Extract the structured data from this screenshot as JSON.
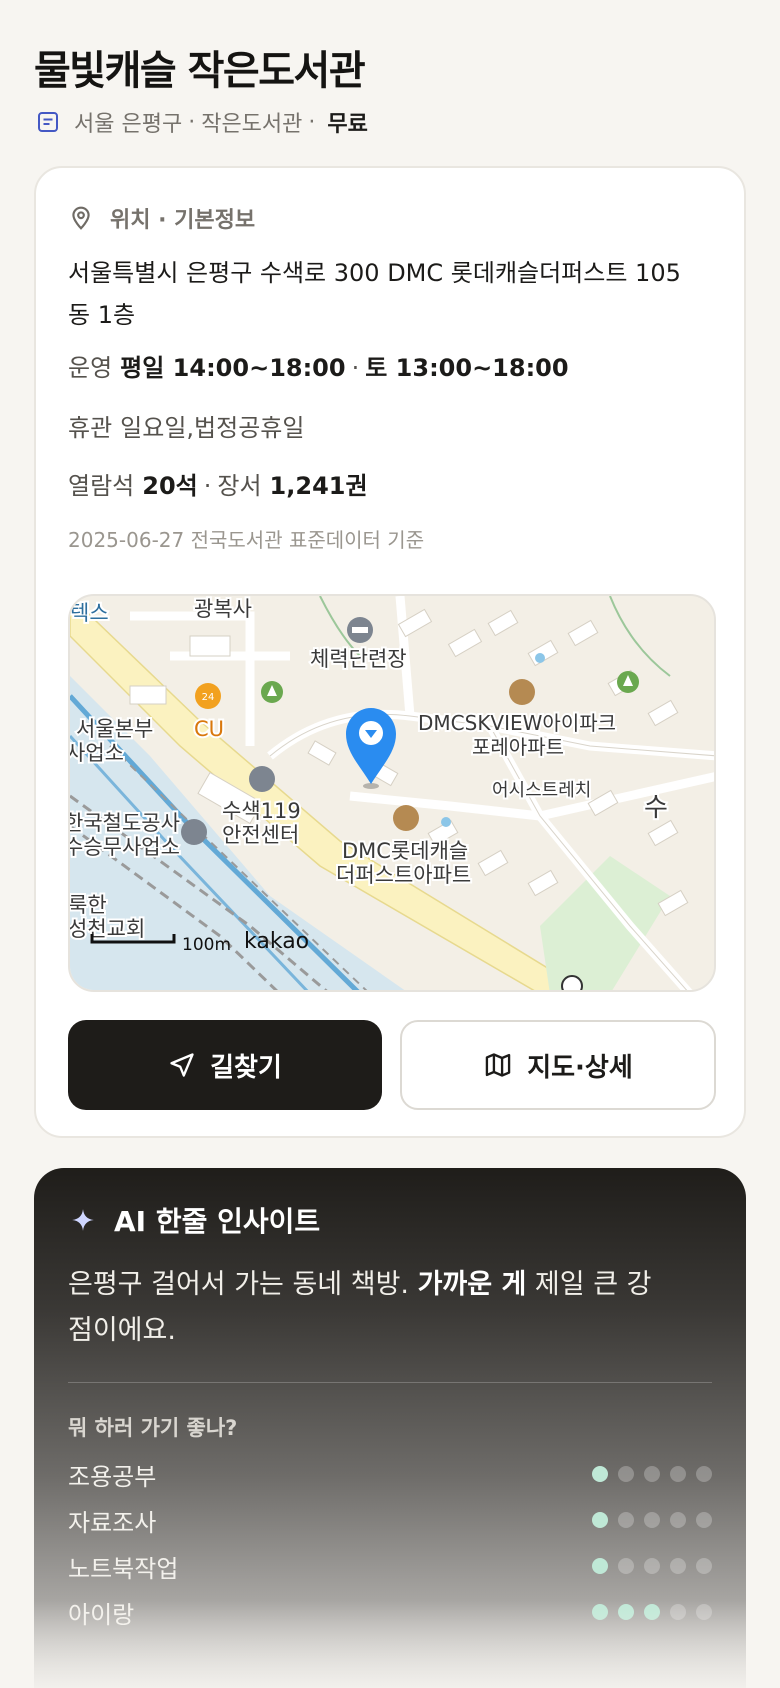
{
  "header": {
    "title": "물빛캐슬 작은도서관",
    "district": "서울 은평구",
    "category": "작은도서관",
    "separator": "·",
    "fee": "무료"
  },
  "info_card": {
    "section_title": "위치 · 기본정보",
    "address": "서울특별시 은평구 수색로 300 DMC 롯데캐슬더퍼스트 105동 1층",
    "hours_label": "운영",
    "weekday_hours": "평일 14:00~18:00",
    "hours_sep": "·",
    "saturday_hours": "토 13:00~18:00",
    "closed_label": "휴관",
    "closed_days": "일요일,법정공휴일",
    "seats_label": "열람석",
    "seats_value": "20석",
    "seats_sep": "·",
    "books_label": "장서",
    "books_value": "1,241권",
    "data_source": "2025-06-27 전국도서관 표준데이터 기준"
  },
  "map": {
    "labels": {
      "l1": "텍스",
      "l2": "광복사",
      "l3": "체력단련장",
      "l4": "CU",
      "l5": "서울본부",
      "l6": "사업소",
      "l7": "DMCSKVIEW아이파크",
      "l8": "포레아파트",
      "l9": "어시스트레치",
      "l10": "수",
      "l11": "수색119",
      "l12": "안전센터",
      "l13": "한국철도공사",
      "l14": "수승무사업소",
      "l15": "DMC롯데캐슬",
      "l16": "더퍼스트아파트",
      "l17": "룩한",
      "l18": "성천교회",
      "scale": "100m",
      "brand": "kakao",
      "cu_badge": "24"
    },
    "colors": {
      "water": "#d6e6ee",
      "river": "#63a9d6",
      "road_major": "#fbf2c0",
      "park": "#dcefd4",
      "marker": "#2a8cf0"
    }
  },
  "buttons": {
    "directions": "길찾기",
    "map_detail": "지도·상세"
  },
  "ai": {
    "title": "AI 한줄 인사이트",
    "text_before": "은평구 걸어서 가는 동네 책방. ",
    "text_bold": "가까운 게",
    "text_after": " 제일 큰 강점이에요.",
    "question": "뭐 하러 가기 좋나?",
    "activities": [
      {
        "name": "조용공부",
        "score": 1,
        "max": 5
      },
      {
        "name": "자료조사",
        "score": 1,
        "max": 5
      },
      {
        "name": "노트북작업",
        "score": 1,
        "max": 5
      },
      {
        "name": "아이랑",
        "score": 3,
        "max": 5
      }
    ]
  },
  "colors": {
    "accent_dark": "#1e1c19",
    "icon_blue": "#4458c4",
    "dot_on": "#bfe8d6"
  }
}
